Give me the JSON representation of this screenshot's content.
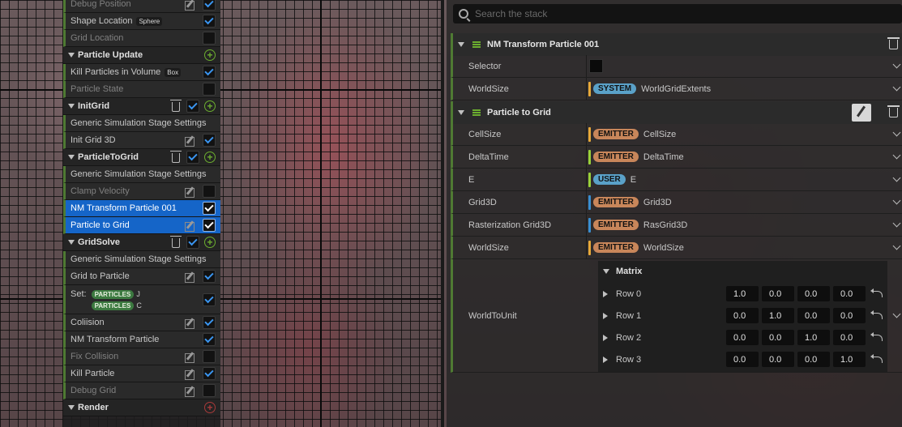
{
  "left_panel": {
    "rows": [
      {
        "label": "Debug Position",
        "kind": "item",
        "dim": true,
        "edit": true,
        "checked": true
      },
      {
        "label": "Shape Location",
        "kind": "item",
        "tag": "Sphere",
        "checked": true
      },
      {
        "label": "Grid Location",
        "kind": "item",
        "dim": true,
        "checked": false
      },
      {
        "label": "Particle Update",
        "kind": "header",
        "plus": true
      },
      {
        "label": "Kill Particles in Volume",
        "kind": "item",
        "tag": "Box",
        "checked": true
      },
      {
        "label": "Particle State",
        "kind": "item",
        "dim": true,
        "checked": false
      },
      {
        "label": "InitGrid",
        "kind": "header",
        "trash": true,
        "checked": true,
        "plus": true
      },
      {
        "label": "Generic Simulation Stage Settings",
        "kind": "item"
      },
      {
        "label": "Init Grid 3D",
        "kind": "item",
        "edit": true,
        "checked": true
      },
      {
        "label": "ParticleToGrid",
        "kind": "header",
        "trash": true,
        "checked": true,
        "plus": true
      },
      {
        "label": "Generic Simulation Stage Settings",
        "kind": "item"
      },
      {
        "label": "Clamp Velocity",
        "kind": "item",
        "dim": true,
        "edit": true,
        "checked": false
      },
      {
        "label": "NM Transform Particle 001",
        "kind": "item",
        "selected": true,
        "checked": true
      },
      {
        "label": "Particle to Grid",
        "kind": "item",
        "selected": true,
        "edit": true,
        "checked": true
      },
      {
        "label": "GridSolve",
        "kind": "header",
        "trash": true,
        "checked": true,
        "plus": true
      },
      {
        "label": "Generic Simulation Stage Settings",
        "kind": "item"
      },
      {
        "label": "Grid to Particle",
        "kind": "item",
        "edit": true,
        "checked": true
      },
      {
        "label": "Set:",
        "kind": "set",
        "pills": [
          {
            "pill": "PARTICLES",
            "letter": "J"
          },
          {
            "pill": "PARTICLES",
            "letter": "C"
          }
        ],
        "checked": true
      },
      {
        "label": "Coliision",
        "kind": "item",
        "edit": true,
        "checked": true
      },
      {
        "label": "NM Transform Particle",
        "kind": "item",
        "checked": true
      },
      {
        "label": "Fix Collision",
        "kind": "item",
        "dim": true,
        "edit": true,
        "checked": false
      },
      {
        "label": "Kill Particle",
        "kind": "item",
        "edit": true,
        "checked": true
      },
      {
        "label": "Debug Grid",
        "kind": "item",
        "dim": true,
        "edit": true,
        "checked": false
      },
      {
        "label": "Render",
        "kind": "header",
        "plusRed": true
      }
    ]
  },
  "stack": {
    "search_placeholder": "Search the stack",
    "section1": {
      "title": "NM Transform Particle 001",
      "params": [
        {
          "label": "Selector",
          "type": "swatch"
        },
        {
          "label": "WorldSize",
          "namespace": "SYSTEM",
          "value": "WorldGridExtents",
          "color": "#e8a93a"
        }
      ]
    },
    "section2": {
      "title": "Particle to Grid",
      "params": [
        {
          "label": "CellSize",
          "namespace": "EMITTER",
          "value": "CellSize",
          "color": "#e8a93a"
        },
        {
          "label": "DeltaTime",
          "namespace": "EMITTER",
          "value": "DeltaTime",
          "color": "#9ad13a"
        },
        {
          "label": "E",
          "namespace": "USER",
          "value": "E",
          "color": "#9ad13a"
        },
        {
          "label": "Grid3D",
          "namespace": "EMITTER",
          "value": "Grid3D",
          "color": "#3a8fd1"
        },
        {
          "label": "Rasterization Grid3D",
          "namespace": "EMITTER",
          "value": "RasGrid3D",
          "color": "#3a8fd1"
        },
        {
          "label": "WorldSize",
          "namespace": "EMITTER",
          "value": "WorldSize",
          "color": "#e8a93a"
        }
      ],
      "matrix": {
        "label": "WorldToUnit",
        "title": "Matrix",
        "rows": [
          {
            "name": "Row 0",
            "values": [
              "1.0",
              "0.0",
              "0.0",
              "0.0"
            ]
          },
          {
            "name": "Row 1",
            "values": [
              "0.0",
              "1.0",
              "0.0",
              "0.0"
            ]
          },
          {
            "name": "Row 2",
            "values": [
              "0.0",
              "0.0",
              "1.0",
              "0.0"
            ]
          },
          {
            "name": "Row 3",
            "values": [
              "0.0",
              "0.0",
              "0.0",
              "1.0"
            ]
          }
        ]
      }
    }
  },
  "colors": {
    "accent_green": "#4f7a33",
    "selection": "#1565c8",
    "check": "#3a95f0"
  }
}
